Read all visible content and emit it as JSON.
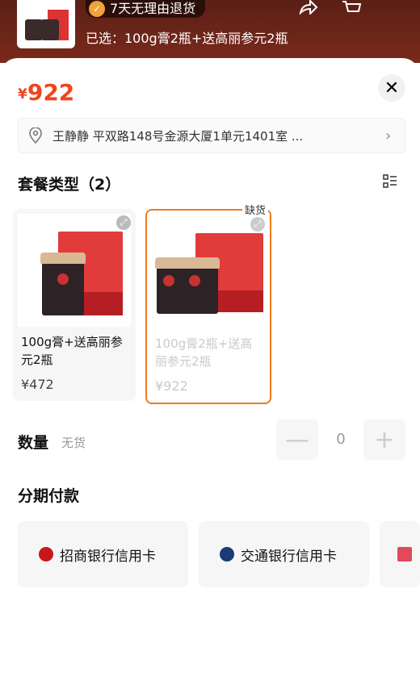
{
  "header": {
    "promo_text": "7天无理由退货",
    "selected_text": "已选：100g膏2瓶+送高丽参元2瓶"
  },
  "sheet": {
    "price_symbol": "¥",
    "price_value": "922",
    "close_label": "✕",
    "address": "王静静 平双路148号金源大厦1单元1401室 ..."
  },
  "package": {
    "title": "套餐类型（2）",
    "out_of_stock_tag": "缺货",
    "options": [
      {
        "name": "100g膏+送高丽参元2瓶",
        "price": "¥472"
      },
      {
        "name": "100g膏2瓶+送高丽参元2瓶",
        "price": "¥922"
      }
    ]
  },
  "quantity": {
    "label": "数量",
    "status": "无货",
    "value": "0",
    "minus": "—",
    "plus": "+"
  },
  "installment": {
    "title": "分期付款",
    "banks": [
      {
        "name": "招商银行信用卡",
        "color": "#c8161d"
      },
      {
        "name": "交通银行信用卡",
        "color": "#1a3a78"
      }
    ]
  },
  "colors": {
    "accent": "#f0451c",
    "selected_border": "#f07a1a"
  }
}
